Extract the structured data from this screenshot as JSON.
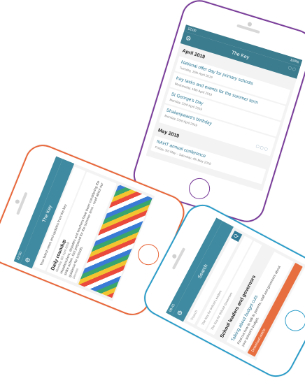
{
  "phone_purple": {
    "status_time": "12:00",
    "status_right": "100%",
    "app_title": "The Key",
    "sections": [
      {
        "title": "April 2019",
        "items": [
          {
            "title": "National offer day for primary schools",
            "date": "Tuesday, 16th April 2019"
          },
          {
            "title": "Key tasks and events for the summer term",
            "date": "Wednesday, 18th April 2019"
          },
          {
            "title": "St George's Day",
            "date": "Monday, 23rd April 2019"
          },
          {
            "title": "Shakespeare's birthday",
            "date": "Monday, 23rd April 2019"
          }
        ]
      },
      {
        "title": "May 2019",
        "items": [
          {
            "title": "NAHT annual conference",
            "date": "Friday, 3rd May – Saturday, 4th May 2019"
          }
        ]
      }
    ]
  },
  "phone_orange": {
    "status_time": "12:00",
    "app_title": "The Key",
    "intro": "Your latest news and updates from the key",
    "post_title": "Daily roundup",
    "post_date": "Monday, 8th April 2019",
    "post_body": "Headteachers, deputies and teachers have been considering the strike action. Get prepared for the summer term - read about our guidance for schools.",
    "post_footer": "Dismiss"
  },
  "phone_blue": {
    "status_time": "09:41",
    "app_title": "Search",
    "search_placeholder": "Search",
    "search_button": "Q",
    "tabs": [
      "The Key for School Leaders",
      "The Key for School Governors"
    ],
    "result_title": "School leaders and governors",
    "results": [
      {
        "title": "Talking about budget cuts",
        "body": "Find out how to talk to parents, staff and governors about your school's budget."
      },
      {
        "title": "Staffing ratios for trips",
        "body": "Read our guidance on appropriate staffing ratios for school trips and outings."
      }
    ],
    "download_label": "Download article"
  },
  "colors": {
    "purple_frame": "#7a3d9a",
    "orange_frame": "#e8673a",
    "blue_frame": "#2a9cc8",
    "app_bar": "#3b7c8e",
    "link": "#2f7a96",
    "accent_button": "#e76f3f"
  }
}
